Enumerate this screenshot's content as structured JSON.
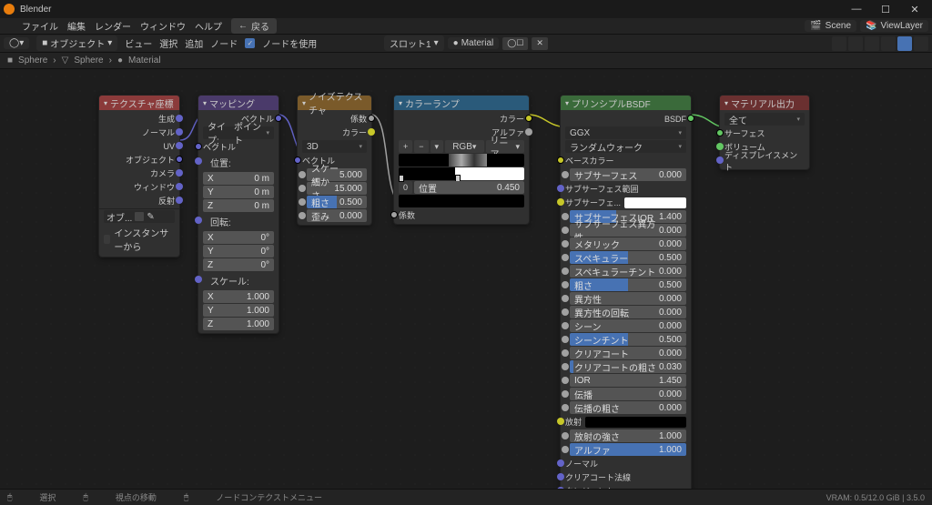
{
  "app": {
    "title": "Blender"
  },
  "menu": {
    "file": "ファイル",
    "edit": "編集",
    "render": "レンダー",
    "window": "ウィンドウ",
    "help": "ヘルプ",
    "back": "戻る"
  },
  "header_right": {
    "scene": "Scene",
    "viewlayer": "ViewLayer"
  },
  "toolbar": {
    "mode": "オブジェクト",
    "view": "ビュー",
    "select": "選択",
    "add": "追加",
    "node": "ノード",
    "use_nodes": "ノードを使用",
    "slot": "スロット1",
    "material": "Material"
  },
  "breadcrumb": {
    "a": "Sphere",
    "b": "Sphere",
    "c": "Material"
  },
  "nodes": {
    "texcoord": {
      "title": "テクスチャ座標",
      "outputs": [
        "生成",
        "ノーマル",
        "UV",
        "オブジェクト",
        "カメラ",
        "ウィンドウ",
        "反射"
      ],
      "object_label": "オブ...",
      "instancer": "インスタンサーから"
    },
    "mapping": {
      "title": "マッピング",
      "out": "ベクトル",
      "type_label": "タイプ:",
      "type_value": "ポイント",
      "in_vector": "ベクトル",
      "loc": "位置:",
      "rot": "回転:",
      "scale": "スケール:",
      "xyz": [
        "X",
        "Y",
        "Z"
      ],
      "loc_vals": [
        "0 m",
        "0 m",
        "0 m"
      ],
      "rot_vals": [
        "0°",
        "0°",
        "0°"
      ],
      "scale_vals": [
        "1.000",
        "1.000",
        "1.000"
      ]
    },
    "noise": {
      "title": "ノイズテクスチャ",
      "out_fac": "係数",
      "out_color": "カラー",
      "dim": "3D",
      "in_vector": "ベクトル",
      "scale": "スケール",
      "scale_v": "5.000",
      "detail": "細かさ",
      "detail_v": "15.000",
      "roughness": "粗さ",
      "roughness_v": "0.500",
      "distortion": "歪み",
      "distortion_v": "0.000"
    },
    "colorramp": {
      "title": "カラーランプ",
      "out_color": "カラー",
      "out_alpha": "アルファ",
      "interp": "RGB",
      "mode": "リニア",
      "pos_label": "位置",
      "pos_value": "0.450",
      "in_fac": "係数"
    },
    "bsdf": {
      "title": "プリンシプルBSDF",
      "out": "BSDF",
      "dist": "GGX",
      "subsurf_method": "ランダムウォーク",
      "base_color": "ベースカラー",
      "params": [
        {
          "l": "サブサーフェス",
          "v": "0.000",
          "p": 0
        },
        {
          "l": "サブサーフェス範囲",
          "v": "",
          "color": true
        },
        {
          "l": "サブサーフェ...",
          "v": "",
          "swatch": "white"
        },
        {
          "l": "サブサーフェスIOR",
          "v": "1.400",
          "p": 40
        },
        {
          "l": "サブサーフェス異方性",
          "v": "0.000",
          "p": 0
        },
        {
          "l": "メタリック",
          "v": "0.000",
          "p": 0
        },
        {
          "l": "スペキュラー",
          "v": "0.500",
          "p": 50
        },
        {
          "l": "スペキュラーチント",
          "v": "0.000",
          "p": 0
        },
        {
          "l": "粗さ",
          "v": "0.500",
          "p": 50
        },
        {
          "l": "異方性",
          "v": "0.000",
          "p": 0
        },
        {
          "l": "異方性の回転",
          "v": "0.000",
          "p": 0
        },
        {
          "l": "シーン",
          "v": "0.000",
          "p": 0
        },
        {
          "l": "シーンチント",
          "v": "0.500",
          "p": 50
        },
        {
          "l": "クリアコート",
          "v": "0.000",
          "p": 0
        },
        {
          "l": "クリアコートの粗さ",
          "v": "0.030",
          "p": 3
        },
        {
          "l": "IOR",
          "v": "1.450",
          "p": 0
        },
        {
          "l": "伝播",
          "v": "0.000",
          "p": 0
        },
        {
          "l": "伝播の粗さ",
          "v": "0.000",
          "p": 0
        }
      ],
      "emission": "放射",
      "emission_strength": "放射の強さ",
      "emission_strength_v": "1.000",
      "alpha": "アルファ",
      "alpha_v": "1.000",
      "normal": "ノーマル",
      "clearcoat_normal": "クリアコート法線",
      "tangent": "タンジェント"
    },
    "output": {
      "title": "マテリアル出力",
      "target": "全て",
      "surface": "サーフェス",
      "volume": "ボリューム",
      "displacement": "ディスプレイスメント"
    }
  },
  "statusbar": {
    "select": "選択",
    "move": "視点の移動",
    "context": "ノードコンテクストメニュー",
    "vram": "VRAM: 0.5/12.0 GiB | 3.5.0"
  }
}
